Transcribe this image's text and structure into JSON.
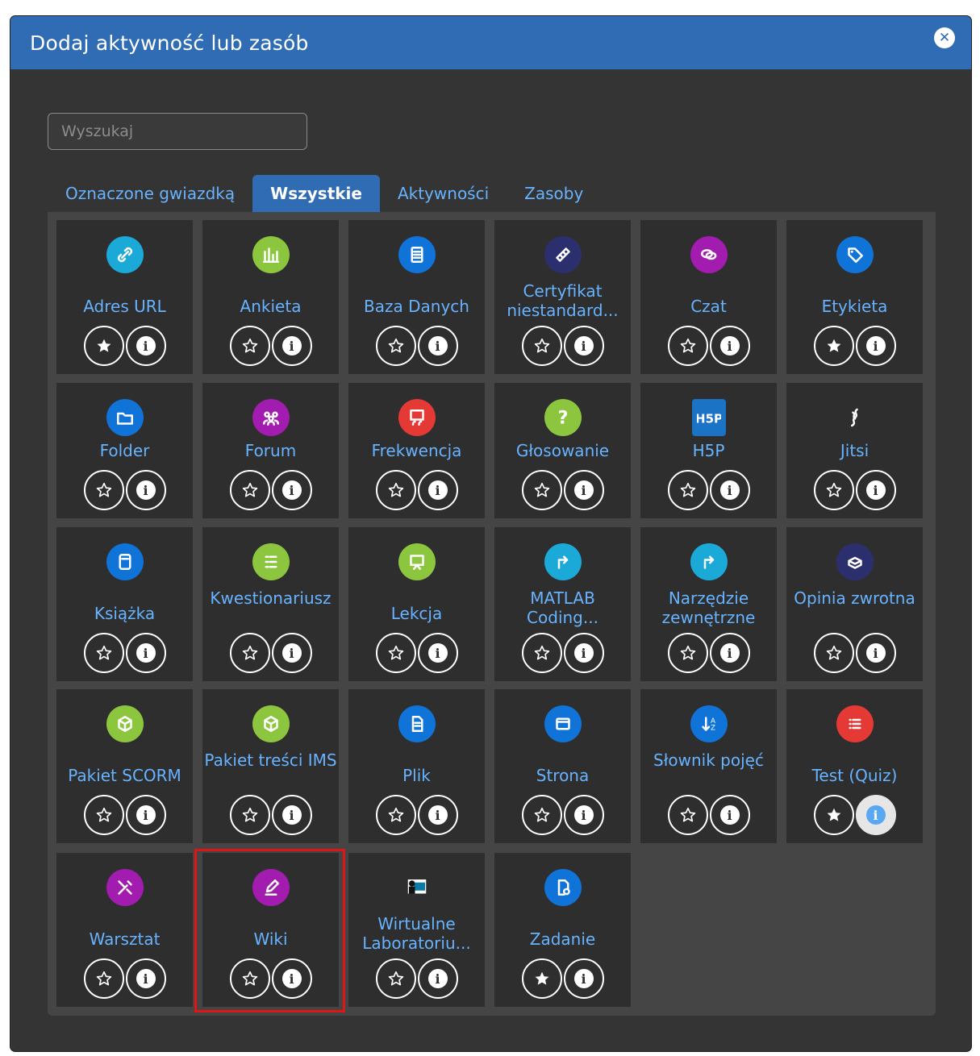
{
  "modal": {
    "title": "Dodaj aktywność lub zasób",
    "close_icon": "close-circle-icon"
  },
  "search": {
    "placeholder": "Wyszukaj",
    "value": ""
  },
  "tabs": [
    {
      "label": "Oznaczone gwiazdką",
      "active": false
    },
    {
      "label": "Wszystkie",
      "active": true
    },
    {
      "label": "Aktywności",
      "active": false
    },
    {
      "label": "Zasoby",
      "active": false
    }
  ],
  "colors": {
    "header": "#2f6cb3",
    "link": "#67b3ff",
    "tile": "#2e2e2e",
    "highlight": "#e01515"
  },
  "items": [
    {
      "label": "Adres URL",
      "icon": "link-icon",
      "color": "#1ba9d8",
      "starred": true
    },
    {
      "label": "Ankieta",
      "icon": "bar-chart-icon",
      "color": "#8cc63f",
      "starred": false
    },
    {
      "label": "Baza Danych",
      "icon": "database-icon",
      "color": "#0f73d8",
      "starred": false
    },
    {
      "label": "Certyfikat niestandard...",
      "icon": "certificate-icon",
      "color": "#2c2f6e",
      "starred": false
    },
    {
      "label": "Czat",
      "icon": "chat-icon",
      "color": "#a21caf",
      "starred": false
    },
    {
      "label": "Etykieta",
      "icon": "tag-icon",
      "color": "#0f73d8",
      "starred": true
    },
    {
      "label": "Folder",
      "icon": "folder-icon",
      "color": "#0f73d8",
      "starred": false
    },
    {
      "label": "Forum",
      "icon": "users-icon",
      "color": "#a21caf",
      "starred": false
    },
    {
      "label": "Frekwencja",
      "icon": "attendance-icon",
      "color": "#e53935",
      "starred": false
    },
    {
      "label": "Głosowanie",
      "icon": "question-icon",
      "color": "#8cc63f",
      "starred": false
    },
    {
      "label": "H5P",
      "icon": "h5p-icon",
      "color": "#1a73c5",
      "starred": false
    },
    {
      "label": "Jitsi",
      "icon": "jitsi-icon",
      "color": "#4e7fd8",
      "starred": false
    },
    {
      "label": "Książka",
      "icon": "book-icon",
      "color": "#0f73d8",
      "starred": false
    },
    {
      "label": "Kwestionariusz",
      "icon": "list-icon",
      "color": "#8cc63f",
      "starred": false
    },
    {
      "label": "Lekcja",
      "icon": "presentation-icon",
      "color": "#8cc63f",
      "starred": false
    },
    {
      "label": "MATLAB Coding...",
      "icon": "external-arrow-icon",
      "color": "#1ba9d8",
      "starred": false
    },
    {
      "label": "Narzędzie zewnętrzne",
      "icon": "external-arrow-icon",
      "color": "#1ba9d8",
      "starred": false
    },
    {
      "label": "Opinia zwrotna",
      "icon": "feedback-box-icon",
      "color": "#2c2f6e",
      "starred": false
    },
    {
      "label": "Pakiet SCORM",
      "icon": "cube-icon",
      "color": "#8cc63f",
      "starred": false
    },
    {
      "label": "Pakiet treści IMS",
      "icon": "cube-icon",
      "color": "#8cc63f",
      "starred": false
    },
    {
      "label": "Plik",
      "icon": "file-icon",
      "color": "#0f73d8",
      "starred": false
    },
    {
      "label": "Strona",
      "icon": "page-icon",
      "color": "#0f73d8",
      "starred": false
    },
    {
      "label": "Słownik pojęć",
      "icon": "sort-az-icon",
      "color": "#0f73d8",
      "starred": false
    },
    {
      "label": "Test (Quiz)",
      "icon": "quiz-list-icon",
      "color": "#e53935",
      "starred": true,
      "info_hover": true
    },
    {
      "label": "Warsztat",
      "icon": "tools-icon",
      "color": "#a21caf",
      "starred": false
    },
    {
      "label": "Wiki",
      "icon": "pencil-icon",
      "color": "#a21caf",
      "starred": false,
      "highlighted": true
    },
    {
      "label": "Wirtualne Laboratoriu...",
      "icon": "computer-user-icon",
      "color": "#2e2e2e",
      "starred": false
    },
    {
      "label": "Zadanie",
      "icon": "assignment-icon",
      "color": "#0f73d8",
      "starred": true
    }
  ]
}
